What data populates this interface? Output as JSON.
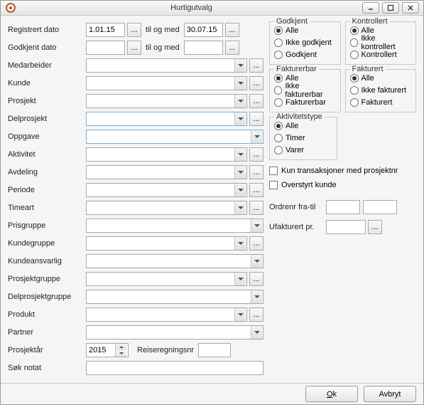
{
  "window": {
    "title": "Hurtigutvalg"
  },
  "winctrl": {
    "min": "min",
    "max": "max",
    "close": "close"
  },
  "labels": {
    "registrert_dato": "Registrert dato",
    "godkjent_dato": "Godkjent dato",
    "til_og_med": "til og med",
    "medarbeider": "Medarbeider",
    "kunde": "Kunde",
    "prosjekt": "Prosjekt",
    "delprosjekt": "Delprosjekt",
    "oppgave": "Oppgave",
    "aktivitet": "Aktivitet",
    "avdeling": "Avdeling",
    "periode": "Periode",
    "timeart": "Timeart",
    "prisgruppe": "Prisgruppe",
    "kundegruppe": "Kundegruppe",
    "kundeansvarlig": "Kundeansvarlig",
    "prosjektgruppe": "Prosjektgruppe",
    "delprosjektgruppe": "Delprosjektgruppe",
    "produkt": "Produkt",
    "partner": "Partner",
    "prosjektar": "Prosjektår",
    "reiseregningsnr": "Reiseregningsnr",
    "sok_notat": "Søk notat"
  },
  "values": {
    "registrert_fra": "1.01.15",
    "registrert_til": "30.07.15",
    "godkjent_fra": "",
    "godkjent_til": "",
    "prosjektar": "2015",
    "reiseregningsnr": "",
    "sok_notat": "",
    "ordrenr_fra": "",
    "ordrenr_til": "",
    "ufakturert_pr": ""
  },
  "groups": {
    "godkjent": {
      "legend": "Godkjent",
      "options": [
        "Alle",
        "Ikke godkjent",
        "Godkjent"
      ],
      "selected": 0
    },
    "kontrollert": {
      "legend": "Kontrollert",
      "options": [
        "Alle",
        "Ikke kontrollert",
        "Kontrollert"
      ],
      "selected": 0
    },
    "fakturerbar": {
      "legend": "Fakturerbar",
      "options": [
        "Alle",
        "Ikke fakturerbar",
        "Fakturerbar"
      ],
      "selected": 0
    },
    "fakturert": {
      "legend": "Fakturert",
      "options": [
        "Alle",
        "Ikke fakturert",
        "Fakturert"
      ],
      "selected": 0
    },
    "aktivitetstype": {
      "legend": "Aktivitetstype",
      "options": [
        "Alle",
        "Timer",
        "Varer"
      ],
      "selected": 0
    }
  },
  "checks": {
    "kun_trans": "Kun transaksjoner med prosjektnr",
    "overstyrt_kunde": "Overstyrt kunde"
  },
  "right_labels": {
    "ordrenr": "Ordrenr fra-til",
    "ufakturert": "Ufakturert pr."
  },
  "buttons": {
    "ok_pre": "O",
    "ok_ul": "k",
    "avbryt": "Avbryt",
    "dots": "..."
  }
}
